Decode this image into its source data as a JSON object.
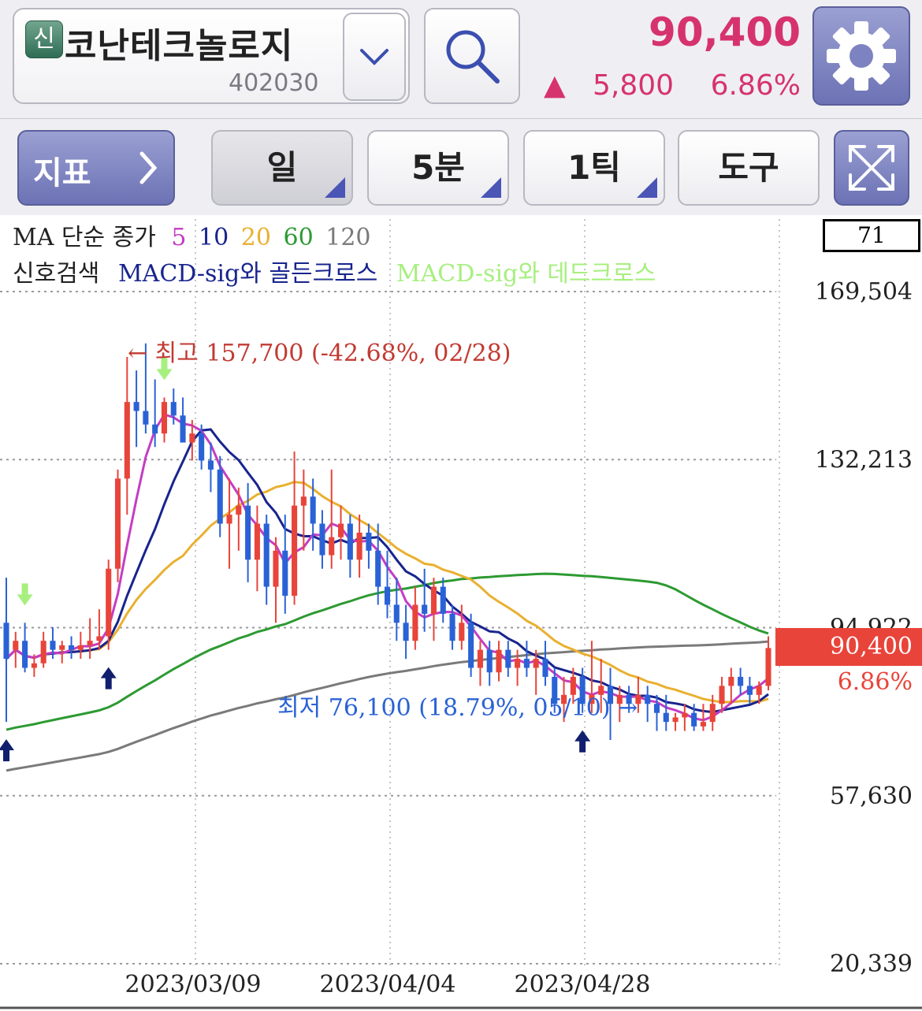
{
  "header": {
    "badge": "신",
    "stock_name": "코난테크놀로지",
    "stock_code": "402030",
    "price": "90,400",
    "change_arrow": "▲",
    "change_amount": "5,800",
    "change_percent": "6.86%"
  },
  "toolbar": {
    "indicator_label": "지표",
    "indicator_chevron": "›",
    "period_day": "일",
    "period_5min": "5분",
    "period_1tick": "1틱",
    "tools": "도구"
  },
  "legend": {
    "ma_prefix": "MA 단순 종가",
    "ma_periods": [
      "5",
      "10",
      "20",
      "60",
      "120"
    ],
    "signal_prefix": "신호검색",
    "golden_cross": "MACD-sig와 골든크로스",
    "dead_cross": "MACD-sig와 데드크로스"
  },
  "colors": {
    "up": "#e8443a",
    "down": "#2a62d6",
    "ma5": "#c43dc4",
    "ma10": "#18248e",
    "ma20": "#e9b030",
    "ma60": "#2d9a32",
    "ma120": "#7a7a7a",
    "golden_signal": "#101f6e",
    "dead_signal": "#a7ef7e"
  },
  "chart_data": {
    "type": "candlestick",
    "y_axis_labels": [
      "169,504",
      "132,213",
      "94,922",
      "57,630",
      "20,339"
    ],
    "ylim": [
      20339,
      169504
    ],
    "x_labels": [
      "2023/03/09",
      "2023/04/04",
      "2023/04/28"
    ],
    "axis_box_value": "71",
    "last_price_label": "90,400",
    "last_change_label": "6.86%",
    "high_annotation": "← 최고 157,700 (-42.68%, 02/28)",
    "low_annotation": "최저 76,100 (18.79%, 05/10) →",
    "candles": [
      [
        96000,
        106000,
        74000,
        88000
      ],
      [
        90000,
        94000,
        86000,
        92000
      ],
      [
        92000,
        96000,
        85000,
        86000
      ],
      [
        86000,
        89000,
        84000,
        87000
      ],
      [
        87000,
        94000,
        86000,
        92000
      ],
      [
        92000,
        95000,
        88000,
        90000
      ],
      [
        90000,
        92000,
        87000,
        91000
      ],
      [
        91000,
        93000,
        88000,
        90000
      ],
      [
        90000,
        94000,
        88000,
        91000
      ],
      [
        91000,
        97000,
        88000,
        92000
      ],
      [
        92000,
        99000,
        90000,
        93000
      ],
      [
        93000,
        110000,
        90000,
        108000
      ],
      [
        108000,
        130000,
        105000,
        128000
      ],
      [
        128000,
        155000,
        120000,
        145000
      ],
      [
        145000,
        152000,
        135000,
        143000
      ],
      [
        143000,
        158000,
        138000,
        140000
      ],
      [
        140000,
        150000,
        135000,
        138000
      ],
      [
        138000,
        146000,
        136000,
        145000
      ],
      [
        145000,
        148000,
        140000,
        142000
      ],
      [
        142000,
        146000,
        138000,
        136000
      ],
      [
        136000,
        141000,
        132000,
        138000
      ],
      [
        138000,
        140000,
        130000,
        132000
      ],
      [
        132000,
        136000,
        125000,
        130000
      ],
      [
        130000,
        133000,
        115000,
        118000
      ],
      [
        118000,
        128000,
        108000,
        120000
      ],
      [
        120000,
        126000,
        112000,
        122000
      ],
      [
        122000,
        127000,
        105000,
        110000
      ],
      [
        110000,
        122000,
        103000,
        118000
      ],
      [
        118000,
        120000,
        100000,
        104000
      ],
      [
        104000,
        115000,
        96000,
        112000
      ],
      [
        112000,
        120000,
        98000,
        102000
      ],
      [
        102000,
        134000,
        100000,
        122000
      ],
      [
        122000,
        130000,
        112000,
        124000
      ],
      [
        124000,
        128000,
        112000,
        118000
      ],
      [
        118000,
        121000,
        108000,
        111000
      ],
      [
        111000,
        130000,
        108000,
        115000
      ],
      [
        115000,
        122000,
        110000,
        118000
      ],
      [
        118000,
        120000,
        106000,
        110000
      ],
      [
        110000,
        120000,
        106000,
        116000
      ],
      [
        116000,
        118000,
        108000,
        112000
      ],
      [
        112000,
        118000,
        100000,
        104000
      ],
      [
        104000,
        112000,
        97000,
        100000
      ],
      [
        100000,
        106000,
        92000,
        96000
      ],
      [
        96000,
        100000,
        88000,
        92000
      ],
      [
        92000,
        104000,
        90000,
        100000
      ],
      [
        100000,
        108000,
        94000,
        98000
      ],
      [
        98000,
        106000,
        92000,
        104000
      ],
      [
        104000,
        106000,
        96000,
        98000
      ],
      [
        98000,
        100000,
        90000,
        92000
      ],
      [
        92000,
        100000,
        90000,
        96000
      ],
      [
        96000,
        98000,
        84000,
        86000
      ],
      [
        86000,
        92000,
        82000,
        90000
      ],
      [
        90000,
        92000,
        82000,
        85000
      ],
      [
        85000,
        92000,
        83000,
        90000
      ],
      [
        90000,
        92000,
        84000,
        86000
      ],
      [
        86000,
        90000,
        82000,
        88000
      ],
      [
        88000,
        92000,
        84000,
        86000
      ],
      [
        86000,
        90000,
        80000,
        88000
      ],
      [
        88000,
        92000,
        82000,
        84000
      ],
      [
        84000,
        86000,
        76000,
        78000
      ],
      [
        78000,
        84000,
        74000,
        80000
      ],
      [
        80000,
        86000,
        78000,
        84000
      ],
      [
        84000,
        86000,
        76000,
        78000
      ],
      [
        78000,
        92000,
        76000,
        80000
      ],
      [
        80000,
        88000,
        76000,
        82000
      ],
      [
        82000,
        86000,
        70000,
        78000
      ],
      [
        78000,
        82000,
        74000,
        80000
      ],
      [
        80000,
        82000,
        76000,
        78000
      ],
      [
        78000,
        84000,
        76000,
        80000
      ],
      [
        80000,
        82000,
        74000,
        78000
      ],
      [
        78000,
        80000,
        72000,
        76000
      ],
      [
        76000,
        80000,
        72000,
        74000
      ],
      [
        74000,
        76000,
        72000,
        75000
      ],
      [
        75000,
        78000,
        72000,
        76000
      ],
      [
        76000,
        78000,
        72000,
        73000
      ],
      [
        73000,
        78000,
        72000,
        74000
      ],
      [
        74000,
        80000,
        72000,
        78000
      ],
      [
        78000,
        84000,
        76000,
        82000
      ],
      [
        82000,
        86000,
        78000,
        84000
      ],
      [
        84000,
        86000,
        80000,
        82000
      ],
      [
        82000,
        84000,
        78000,
        80000
      ],
      [
        80000,
        83000,
        78000,
        82000
      ],
      [
        82000,
        93000,
        81000,
        90400
      ]
    ],
    "signals_golden": [
      0,
      11,
      62
    ],
    "signals_dead": [
      2,
      17
    ]
  }
}
